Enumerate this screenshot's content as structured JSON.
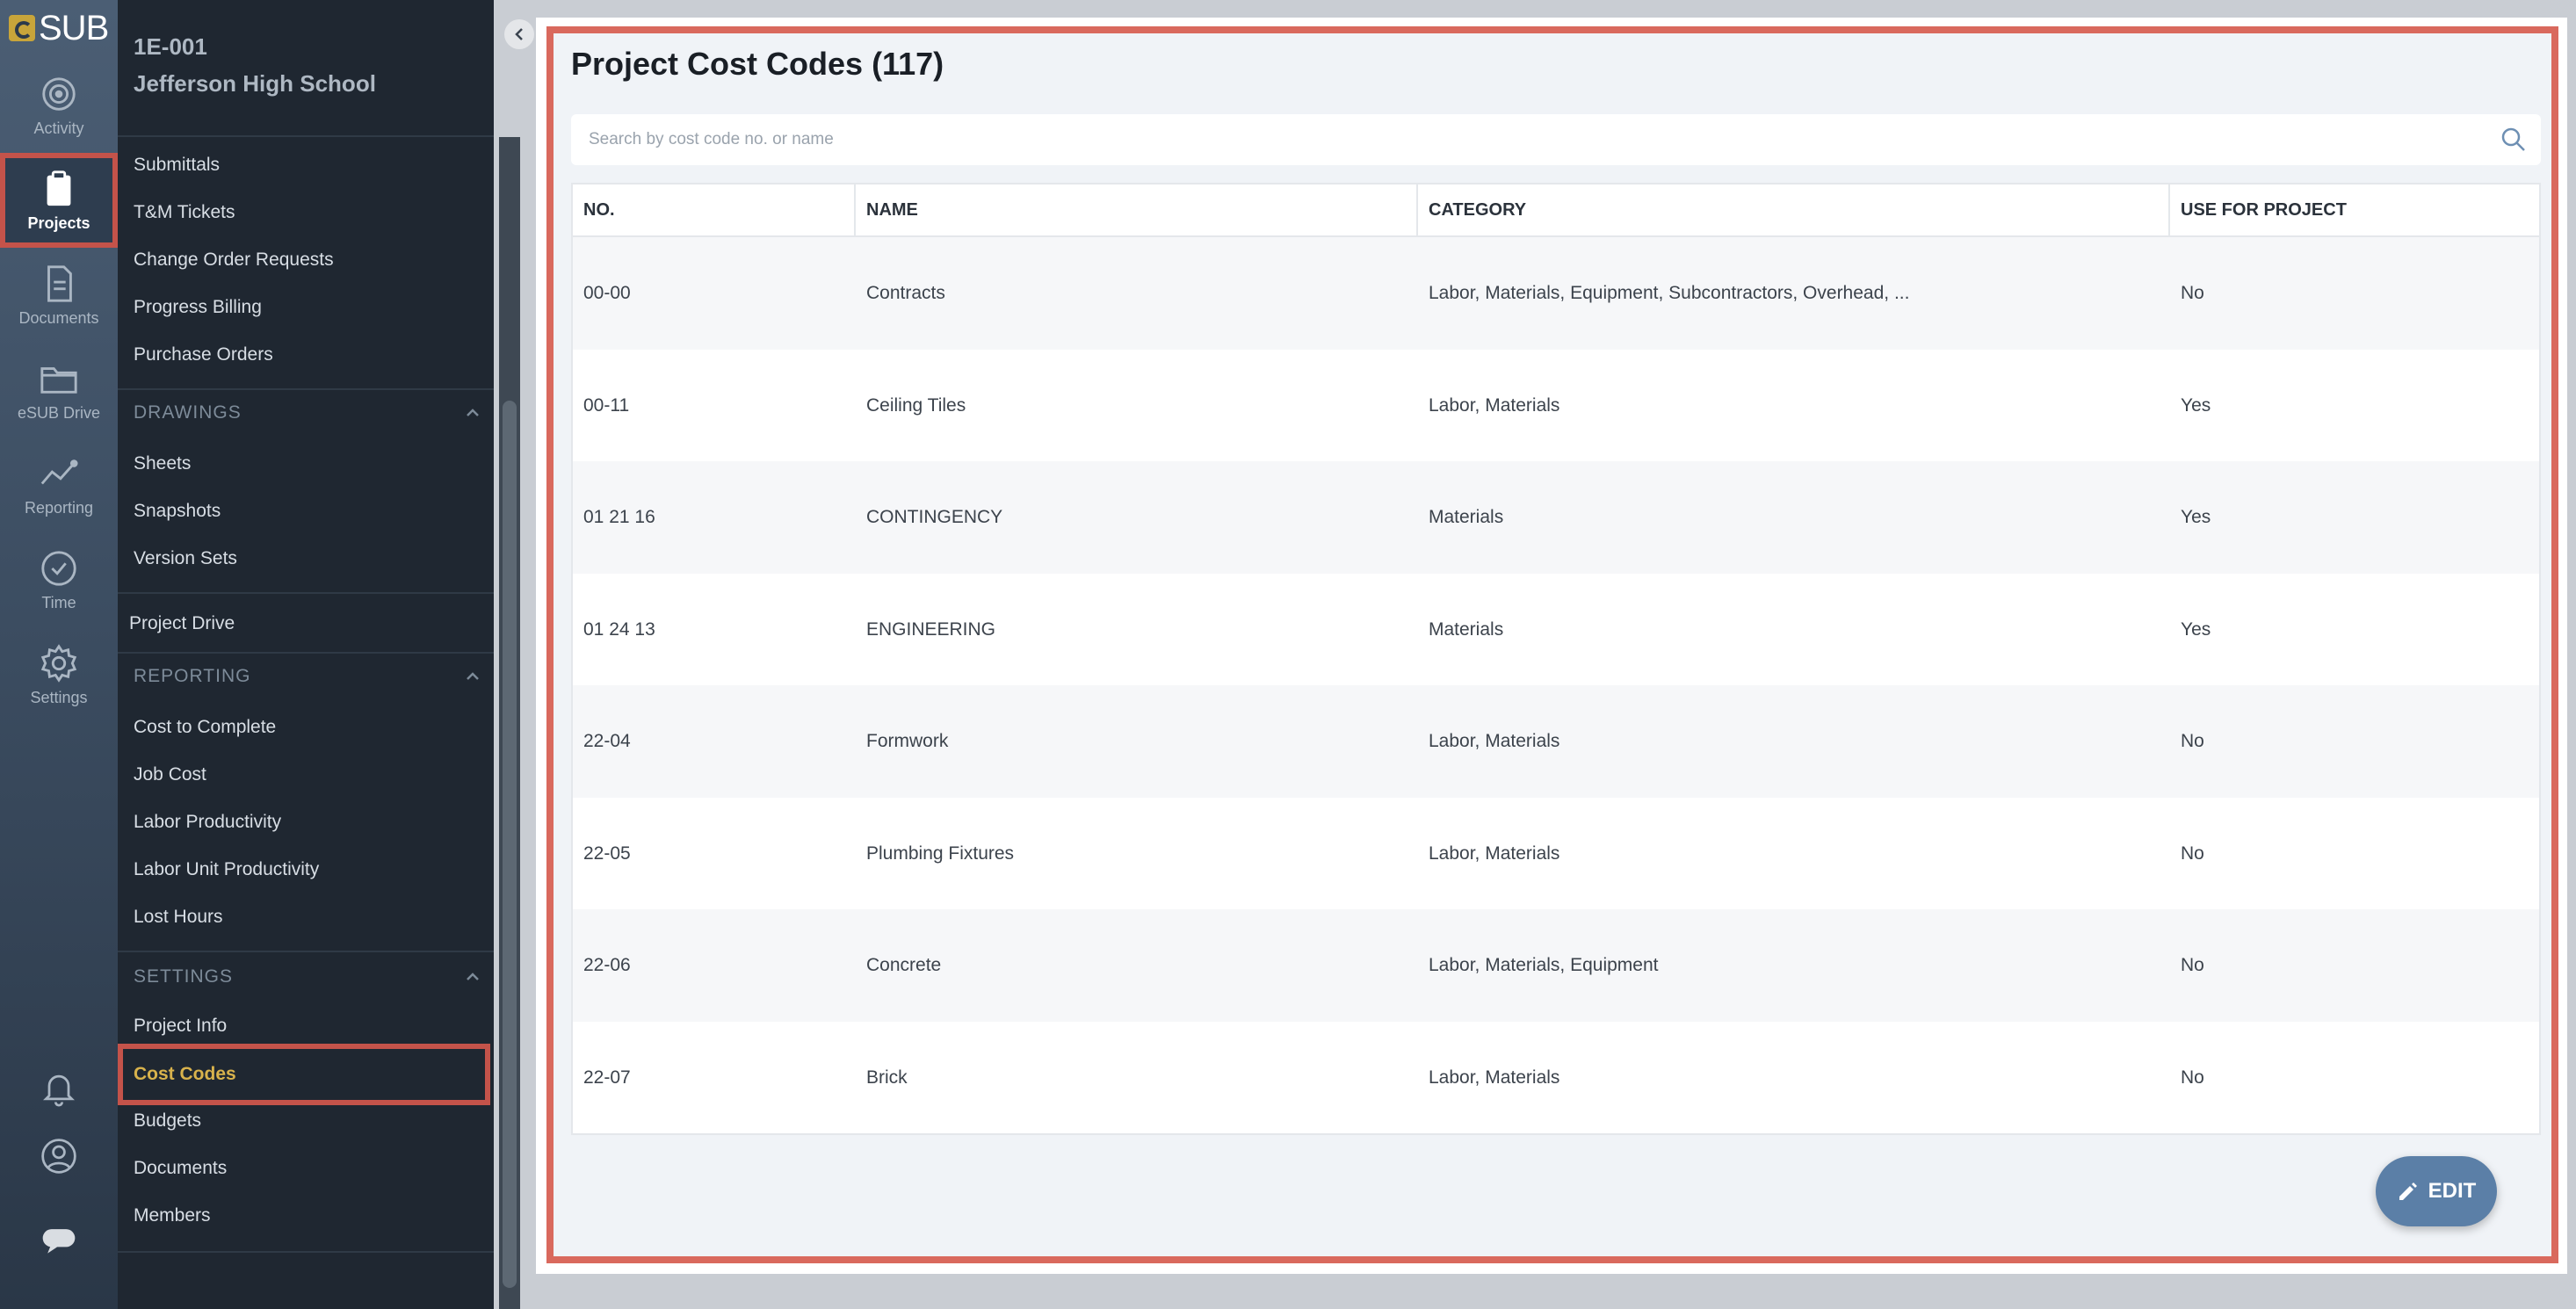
{
  "brand": {
    "logo_text": "SUB"
  },
  "rail": {
    "items": [
      {
        "label": "Activity",
        "icon": "activity-icon"
      },
      {
        "label": "Projects",
        "icon": "clipboard-icon",
        "active": true
      },
      {
        "label": "Documents",
        "icon": "document-icon"
      },
      {
        "label": "eSUB Drive",
        "icon": "folder-icon"
      },
      {
        "label": "Reporting",
        "icon": "chart-icon"
      },
      {
        "label": "Time",
        "icon": "clock-icon"
      },
      {
        "label": "Settings",
        "icon": "gear-icon"
      }
    ]
  },
  "project": {
    "code": "1E-001",
    "name": "Jefferson High School"
  },
  "sidebar": {
    "top_items": [
      "Submittals",
      "T&M Tickets",
      "Change Order Requests",
      "Progress Billing",
      "Purchase Orders"
    ],
    "drawings": {
      "title": "DRAWINGS",
      "items": [
        "Sheets",
        "Snapshots",
        "Version Sets"
      ]
    },
    "project_drive": "Project Drive",
    "reporting": {
      "title": "REPORTING",
      "items": [
        "Cost to Complete",
        "Job Cost",
        "Labor Productivity",
        "Labor Unit Productivity",
        "Lost Hours"
      ]
    },
    "settings": {
      "title": "SETTINGS",
      "items": [
        "Project Info",
        "Cost Codes",
        "Budgets",
        "Documents",
        "Members"
      ],
      "selected": "Cost Codes"
    }
  },
  "main": {
    "title": "Project Cost Codes (117)",
    "search_placeholder": "Search by cost code no. or name",
    "columns": [
      "NO.",
      "NAME",
      "CATEGORY",
      "USE FOR PROJECT"
    ],
    "rows": [
      {
        "no": "00-00",
        "name": "Contracts",
        "category": "Labor, Materials, Equipment, Subcontractors, Overhead, ...",
        "use": "No"
      },
      {
        "no": "00-11",
        "name": "Ceiling Tiles",
        "category": "Labor, Materials",
        "use": "Yes"
      },
      {
        "no": "01 21 16",
        "name": "CONTINGENCY",
        "category": "Materials",
        "use": "Yes"
      },
      {
        "no": "01 24 13",
        "name": "ENGINEERING",
        "category": "Materials",
        "use": "Yes"
      },
      {
        "no": "22-04",
        "name": "Formwork",
        "category": "Labor, Materials",
        "use": "No"
      },
      {
        "no": "22-05",
        "name": "Plumbing Fixtures",
        "category": "Labor, Materials",
        "use": "No"
      },
      {
        "no": "22-06",
        "name": "Concrete",
        "category": "Labor, Materials, Equipment",
        "use": "No"
      },
      {
        "no": "22-07",
        "name": "Brick",
        "category": "Labor, Materials",
        "use": "No"
      }
    ],
    "edit_label": "EDIT"
  },
  "colors": {
    "highlight": "#c4534a",
    "selected_text": "#d8b24c",
    "edit_button": "#5b7fa7"
  }
}
